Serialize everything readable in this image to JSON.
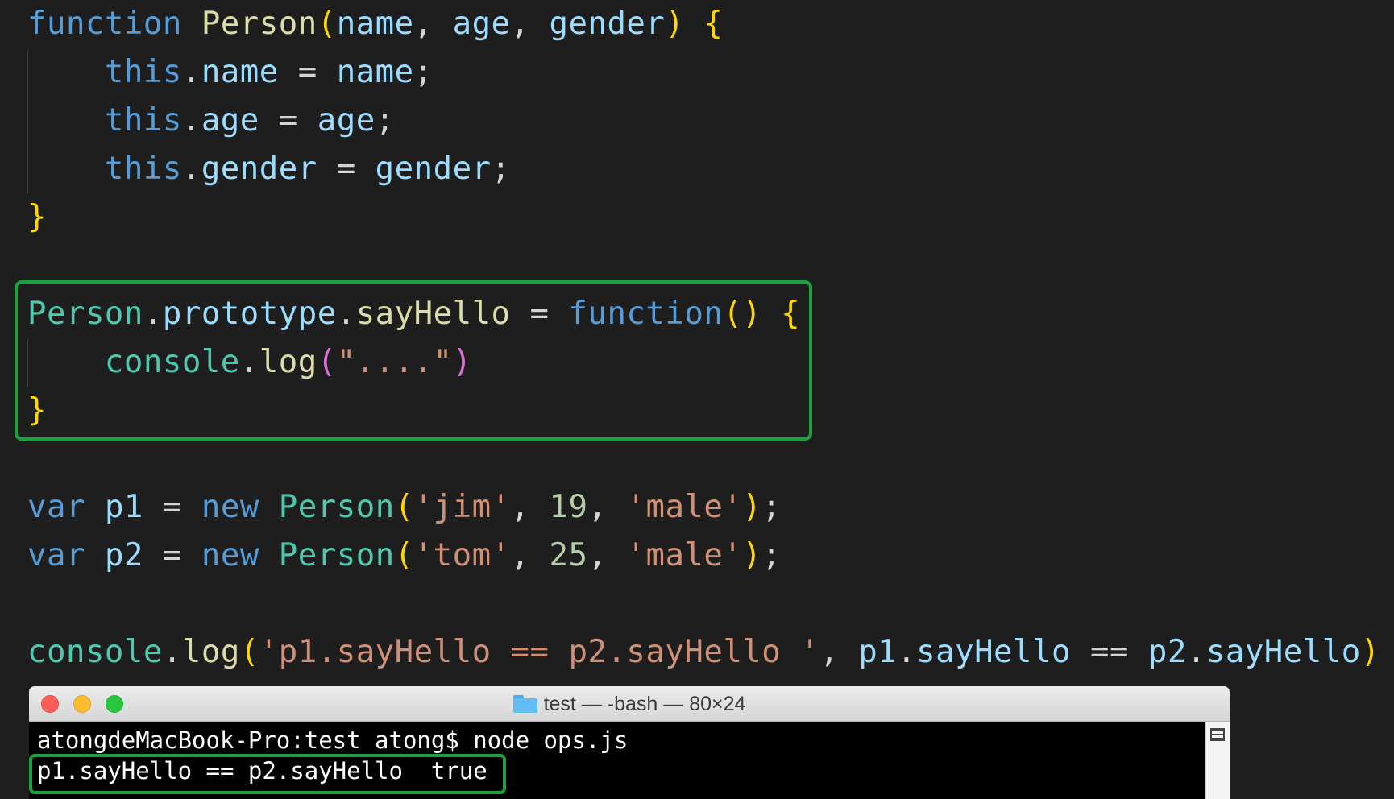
{
  "colors": {
    "editor_bg": "#1e1e1e",
    "keyword": "#569cd6",
    "function_name": "#dcdcaa",
    "class_name": "#4ec9b0",
    "variable": "#9cdcfe",
    "string": "#ce9178",
    "number": "#b5cea8",
    "bracket_yellow": "#ffd700",
    "bracket_pink": "#da70d6",
    "punctuation": "#d4d4d4",
    "highlight_border": "#18a33c",
    "terminal_close": "#fc5f57",
    "terminal_minimize": "#fdbc2e",
    "terminal_maximize": "#29c73f"
  },
  "editor": {
    "lines": [
      [
        {
          "t": "function",
          "c": "keyword"
        },
        {
          "t": " ",
          "c": "punctuation"
        },
        {
          "t": "Person",
          "c": "function_name"
        },
        {
          "t": "(",
          "c": "bracket_yellow"
        },
        {
          "t": "name",
          "c": "variable"
        },
        {
          "t": ", ",
          "c": "punctuation"
        },
        {
          "t": "age",
          "c": "variable"
        },
        {
          "t": ", ",
          "c": "punctuation"
        },
        {
          "t": "gender",
          "c": "variable"
        },
        {
          "t": ")",
          "c": "bracket_yellow"
        },
        {
          "t": " ",
          "c": "punctuation"
        },
        {
          "t": "{",
          "c": "bracket_yellow"
        }
      ],
      [
        {
          "t": "    ",
          "c": "punctuation"
        },
        {
          "t": "this",
          "c": "keyword"
        },
        {
          "t": ".",
          "c": "punctuation"
        },
        {
          "t": "name",
          "c": "variable"
        },
        {
          "t": " = ",
          "c": "punctuation"
        },
        {
          "t": "name",
          "c": "variable"
        },
        {
          "t": ";",
          "c": "punctuation"
        }
      ],
      [
        {
          "t": "    ",
          "c": "punctuation"
        },
        {
          "t": "this",
          "c": "keyword"
        },
        {
          "t": ".",
          "c": "punctuation"
        },
        {
          "t": "age",
          "c": "variable"
        },
        {
          "t": " = ",
          "c": "punctuation"
        },
        {
          "t": "age",
          "c": "variable"
        },
        {
          "t": ";",
          "c": "punctuation"
        }
      ],
      [
        {
          "t": "    ",
          "c": "punctuation"
        },
        {
          "t": "this",
          "c": "keyword"
        },
        {
          "t": ".",
          "c": "punctuation"
        },
        {
          "t": "gender",
          "c": "variable"
        },
        {
          "t": " = ",
          "c": "punctuation"
        },
        {
          "t": "gender",
          "c": "variable"
        },
        {
          "t": ";",
          "c": "punctuation"
        }
      ],
      [
        {
          "t": "}",
          "c": "bracket_yellow"
        }
      ],
      [],
      [
        {
          "t": "Person",
          "c": "class_name"
        },
        {
          "t": ".",
          "c": "punctuation"
        },
        {
          "t": "prototype",
          "c": "variable"
        },
        {
          "t": ".",
          "c": "punctuation"
        },
        {
          "t": "sayHello",
          "c": "function_name"
        },
        {
          "t": " = ",
          "c": "punctuation"
        },
        {
          "t": "function",
          "c": "keyword"
        },
        {
          "t": "()",
          "c": "bracket_yellow"
        },
        {
          "t": " ",
          "c": "punctuation"
        },
        {
          "t": "{",
          "c": "bracket_yellow"
        }
      ],
      [
        {
          "t": "    ",
          "c": "punctuation"
        },
        {
          "t": "console",
          "c": "class_name"
        },
        {
          "t": ".",
          "c": "punctuation"
        },
        {
          "t": "log",
          "c": "function_name"
        },
        {
          "t": "(",
          "c": "bracket_pink"
        },
        {
          "t": "\"....\"",
          "c": "string"
        },
        {
          "t": ")",
          "c": "bracket_pink"
        }
      ],
      [
        {
          "t": "}",
          "c": "bracket_yellow"
        }
      ],
      [],
      [
        {
          "t": "var",
          "c": "keyword"
        },
        {
          "t": " ",
          "c": "punctuation"
        },
        {
          "t": "p1",
          "c": "variable"
        },
        {
          "t": " = ",
          "c": "punctuation"
        },
        {
          "t": "new",
          "c": "keyword"
        },
        {
          "t": " ",
          "c": "punctuation"
        },
        {
          "t": "Person",
          "c": "class_name"
        },
        {
          "t": "(",
          "c": "bracket_yellow"
        },
        {
          "t": "'jim'",
          "c": "string"
        },
        {
          "t": ", ",
          "c": "punctuation"
        },
        {
          "t": "19",
          "c": "number"
        },
        {
          "t": ", ",
          "c": "punctuation"
        },
        {
          "t": "'male'",
          "c": "string"
        },
        {
          "t": ")",
          "c": "bracket_yellow"
        },
        {
          "t": ";",
          "c": "punctuation"
        }
      ],
      [
        {
          "t": "var",
          "c": "keyword"
        },
        {
          "t": " ",
          "c": "punctuation"
        },
        {
          "t": "p2",
          "c": "variable"
        },
        {
          "t": " = ",
          "c": "punctuation"
        },
        {
          "t": "new",
          "c": "keyword"
        },
        {
          "t": " ",
          "c": "punctuation"
        },
        {
          "t": "Person",
          "c": "class_name"
        },
        {
          "t": "(",
          "c": "bracket_yellow"
        },
        {
          "t": "'tom'",
          "c": "string"
        },
        {
          "t": ", ",
          "c": "punctuation"
        },
        {
          "t": "25",
          "c": "number"
        },
        {
          "t": ", ",
          "c": "punctuation"
        },
        {
          "t": "'male'",
          "c": "string"
        },
        {
          "t": ")",
          "c": "bracket_yellow"
        },
        {
          "t": ";",
          "c": "punctuation"
        }
      ],
      [],
      [
        {
          "t": "console",
          "c": "class_name"
        },
        {
          "t": ".",
          "c": "punctuation"
        },
        {
          "t": "log",
          "c": "function_name"
        },
        {
          "t": "(",
          "c": "bracket_yellow"
        },
        {
          "t": "'p1.sayHello == p2.sayHello '",
          "c": "string"
        },
        {
          "t": ", ",
          "c": "punctuation"
        },
        {
          "t": "p1",
          "c": "variable"
        },
        {
          "t": ".",
          "c": "punctuation"
        },
        {
          "t": "sayHello",
          "c": "variable"
        },
        {
          "t": " == ",
          "c": "punctuation"
        },
        {
          "t": "p2",
          "c": "variable"
        },
        {
          "t": ".",
          "c": "punctuation"
        },
        {
          "t": "sayHello",
          "c": "variable"
        },
        {
          "t": ")",
          "c": "bracket_yellow"
        }
      ]
    ]
  },
  "terminal": {
    "title": "test — -bash — 80×24",
    "prompt_line": "atongdeMacBook-Pro:test atong$ node ops.js",
    "output_line": "p1.sayHello == p2.sayHello  true",
    "folder_icon": "folder-icon"
  }
}
